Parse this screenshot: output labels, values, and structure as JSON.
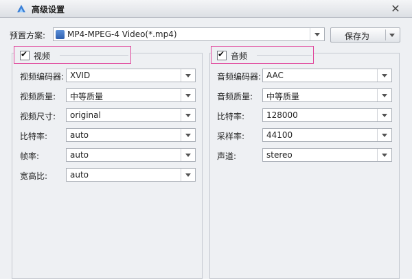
{
  "window": {
    "title": "高级设置",
    "close_glyph": "✕"
  },
  "preset": {
    "label": "预置方案:",
    "value": "MP4-MPEG-4 Video(*.mp4)",
    "save_as": "保存为"
  },
  "video": {
    "title": "视频",
    "enabled": true,
    "rows": [
      {
        "label": "视频编码器:",
        "value": "XVID"
      },
      {
        "label": "视频质量:",
        "value": "中等质量"
      },
      {
        "label": "视频尺寸:",
        "value": "original"
      },
      {
        "label": "比特率:",
        "value": "auto"
      },
      {
        "label": "帧率:",
        "value": "auto"
      },
      {
        "label": "宽高比:",
        "value": "auto"
      }
    ]
  },
  "audio": {
    "title": "音频",
    "enabled": true,
    "rows": [
      {
        "label": "音频编码器:",
        "value": "AAC"
      },
      {
        "label": "音频质量:",
        "value": "中等质量"
      },
      {
        "label": "比特率:",
        "value": "128000"
      },
      {
        "label": "采样率:",
        "value": "44100"
      },
      {
        "label": "声道:",
        "value": "stereo"
      }
    ]
  },
  "colors": {
    "highlight_border": "#e0439a"
  },
  "icons": {
    "app": "app-logo-icon",
    "preset": "video-file-icon"
  }
}
